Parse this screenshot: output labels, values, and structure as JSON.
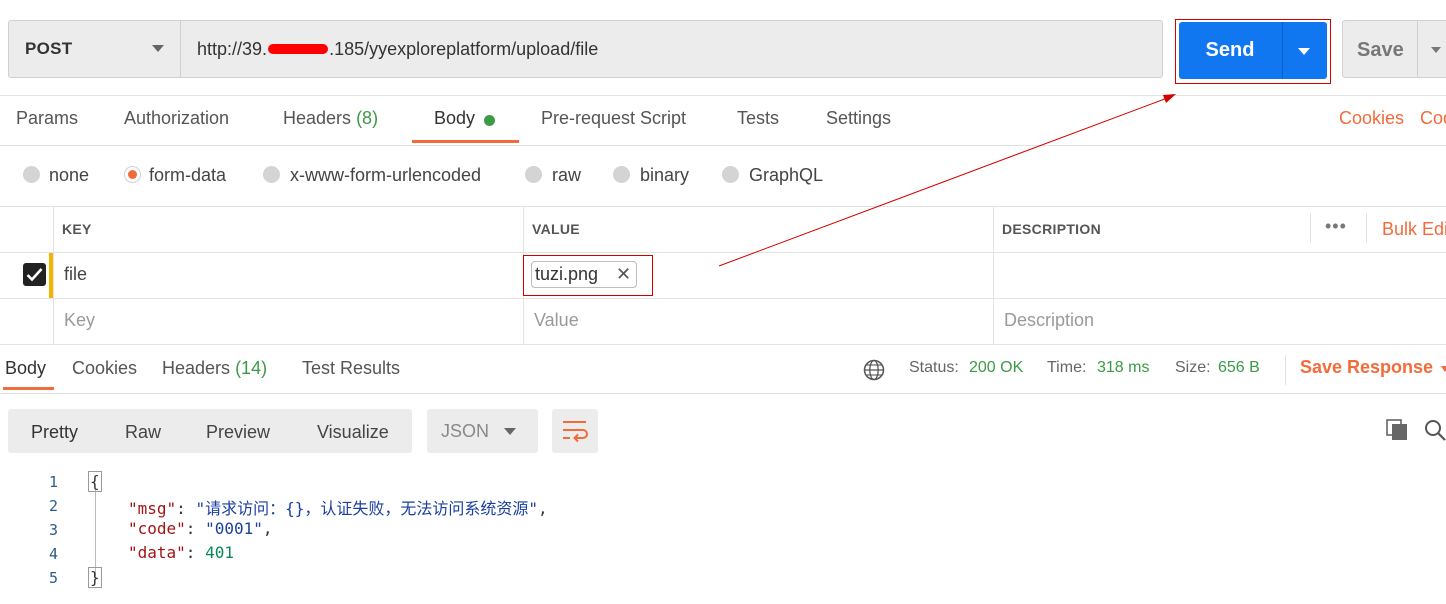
{
  "request": {
    "method": "POST",
    "url_prefix": "http://39.",
    "url_suffix": ".185/yyexploreplatform/upload/file",
    "send_label": "Send",
    "save_label": "Save"
  },
  "request_tabs": {
    "params": "Params",
    "authorization": "Authorization",
    "headers": "Headers",
    "headers_count": "(8)",
    "body": "Body",
    "pre_request": "Pre-request Script",
    "tests": "Tests",
    "settings": "Settings",
    "cookies": "Cookies",
    "code": "Code"
  },
  "body_types": {
    "none": "none",
    "form_data": "form-data",
    "urlencoded": "x-www-form-urlencoded",
    "raw": "raw",
    "binary": "binary",
    "graphql": "GraphQL",
    "selected": "form-data"
  },
  "form_table": {
    "col_key": "KEY",
    "col_value": "VALUE",
    "col_description": "DESCRIPTION",
    "bulk_edit": "Bulk Edit",
    "rows": [
      {
        "key": "file",
        "value": "tuzi.png",
        "checked": true
      }
    ],
    "placeholders": {
      "key": "Key",
      "value": "Value",
      "description": "Description"
    }
  },
  "response_tabs": {
    "body": "Body",
    "cookies": "Cookies",
    "headers": "Headers",
    "headers_count": "(14)",
    "test_results": "Test Results"
  },
  "status": {
    "status_label": "Status:",
    "status_value": "200 OK",
    "time_label": "Time:",
    "time_value": "318 ms",
    "size_label": "Size:",
    "size_value": "656 B",
    "save_response": "Save Response"
  },
  "view_modes": {
    "pretty": "Pretty",
    "raw": "Raw",
    "preview": "Preview",
    "visualize": "Visualize",
    "format": "JSON"
  },
  "response_code": {
    "line_numbers": [
      "1",
      "2",
      "3",
      "4",
      "5"
    ],
    "open_brace": "{",
    "close_brace": "}",
    "msg_key": "\"msg\"",
    "msg_value": "\"请求访问：{}，认证失败，无法访问系统资源\"",
    "code_key": "\"code\"",
    "code_value": "\"0001\"",
    "data_key": "\"data\"",
    "data_value": "401"
  },
  "colors": {
    "accent": "#f26b3a",
    "send_button": "#1177f0",
    "success": "#3c9a45",
    "annotation": "#d40000"
  }
}
